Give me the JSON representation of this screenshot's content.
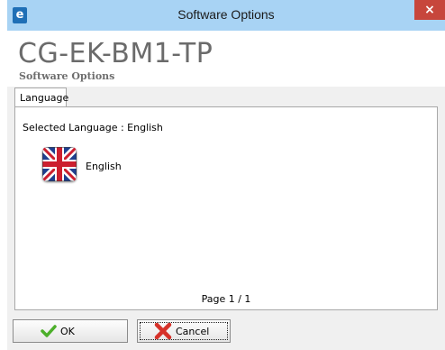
{
  "window": {
    "title": "Software Options",
    "app_icon_letter": "e",
    "close_glyph": "×"
  },
  "header": {
    "product_name": "CG-EK-BM1-TP",
    "subtitle": "Software Options"
  },
  "tabs": [
    {
      "label": "Language",
      "active": true
    }
  ],
  "language_panel": {
    "selected_text": "Selected Language : English",
    "languages": [
      {
        "label": "English",
        "icon": "uk-flag-icon"
      }
    ],
    "page_indicator": "Page 1 / 1"
  },
  "footer": {
    "ok_label": "OK",
    "ok_icon": "check-icon",
    "cancel_label": "Cancel",
    "cancel_icon": "x-icon"
  },
  "colors": {
    "titlebar": "#a8d3f4",
    "close_button": "#c7463c",
    "app_icon": "#1f6fb6"
  }
}
